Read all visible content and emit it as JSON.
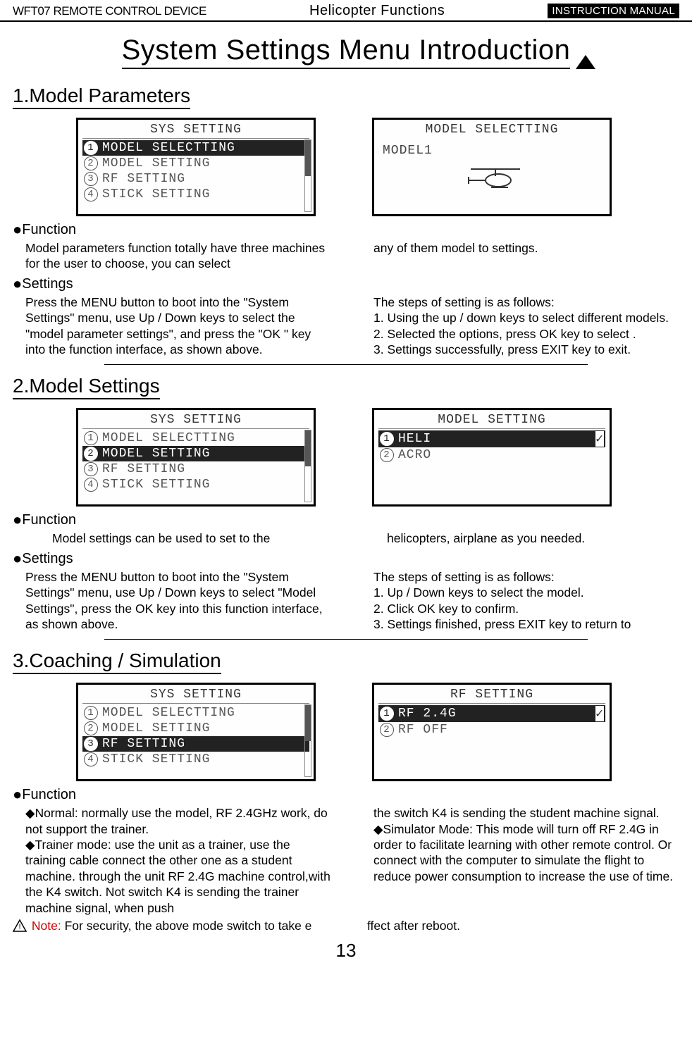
{
  "header": {
    "left": "WFT07 REMOTE CONTROL DEVICE",
    "center": "Helicopter Functions",
    "right": "INSTRUCTION MANUAL"
  },
  "main_heading": "System Settings Menu Introduction",
  "sections": {
    "s1": {
      "title": "1.Model Parameters",
      "lcd_left": {
        "title": "SYS SETTING",
        "rows": [
          {
            "n": "1",
            "label": "MODEL SELECTTING",
            "sel": true
          },
          {
            "n": "2",
            "label": "MODEL SETTING",
            "sel": false
          },
          {
            "n": "3",
            "label": "RF SETTING",
            "sel": false
          },
          {
            "n": "4",
            "label": "STICK SETTING",
            "sel": false
          }
        ]
      },
      "lcd_right": {
        "title": "MODEL SELECTTING",
        "body_line": "MODEL1"
      },
      "function_head": "Function",
      "function_left": "Model parameters function totally have three machines for the user to choose, you can select",
      "function_right": "any of them model to settings.",
      "settings_head": "Settings",
      "settings_left": "Press the MENU button to boot into the \"System Settings\" menu, use Up / Down keys to select the \"model parameter settings\", and press the \"OK \" key into the function interface, as shown above.",
      "settings_right": "The steps of setting is as follows:\n1. Using the up / down keys to select different models.\n2. Selected the options, press OK key to select .\n3. Settings successfully, press EXIT key to exit."
    },
    "s2": {
      "title": "2.Model Settings",
      "lcd_left": {
        "title": "SYS SETTING",
        "rows": [
          {
            "n": "1",
            "label": "MODEL SELECTTING",
            "sel": false
          },
          {
            "n": "2",
            "label": "MODEL SETTING",
            "sel": true
          },
          {
            "n": "3",
            "label": "RF SETTING",
            "sel": false
          },
          {
            "n": "4",
            "label": "STICK SETTING",
            "sel": false
          }
        ]
      },
      "lcd_right": {
        "title": "MODEL SETTING",
        "rows": [
          {
            "n": "1",
            "label": "HELI",
            "sel": true,
            "check": true
          },
          {
            "n": "2",
            "label": "ACRO",
            "sel": false,
            "check": false
          }
        ]
      },
      "function_head": "Function",
      "function_left": "Model settings can be used to set to the",
      "function_right": "helicopters, airplane as you needed.",
      "settings_head": "Settings",
      "settings_left": "Press the MENU button to boot into the \"System Settings\" menu, use Up / Down keys to select \"Model Settings\", press the OK key into this function interface, as shown above.",
      "settings_right": "The steps of setting is as follows:\n1. Up / Down keys to select the model.\n2. Click OK key to confirm.\n3. Settings finished, press EXIT key to return to"
    },
    "s3": {
      "title": "3.Coaching / Simulation",
      "lcd_left": {
        "title": "SYS SETTING",
        "rows": [
          {
            "n": "1",
            "label": "MODEL SELECTTING",
            "sel": false
          },
          {
            "n": "2",
            "label": "MODEL SETTING",
            "sel": false
          },
          {
            "n": "3",
            "label": "RF SETTING",
            "sel": true
          },
          {
            "n": "4",
            "label": "STICK SETTING",
            "sel": false
          }
        ]
      },
      "lcd_right": {
        "title": "RF SETTING",
        "rows": [
          {
            "n": "1",
            "label": "RF 2.4G",
            "sel": true,
            "check": true
          },
          {
            "n": "2",
            "label": "RF OFF",
            "sel": false,
            "check": false
          }
        ]
      },
      "function_head": "Function",
      "function_left": "◆Normal: normally use the model, RF 2.4GHz work, do not support the trainer.\n◆Trainer mode: use the unit as a trainer, use the training cable connect the other one as a student machine. through the unit RF 2.4G machine control,with the K4 switch. Not switch K4 is sending the trainer machine signal, when push",
      "function_right": "the switch K4 is sending the student machine signal.\n◆Simulator Mode: This mode will turn off RF 2.4G in order to facilitate learning with other remote control. Or connect with the computer to simulate the flight to reduce power consumption to increase the use of time.",
      "note_label": "Note:",
      "note_left": "For security, the above mode switch to take e",
      "note_right": "ffect after reboot."
    }
  },
  "page_number": "13"
}
